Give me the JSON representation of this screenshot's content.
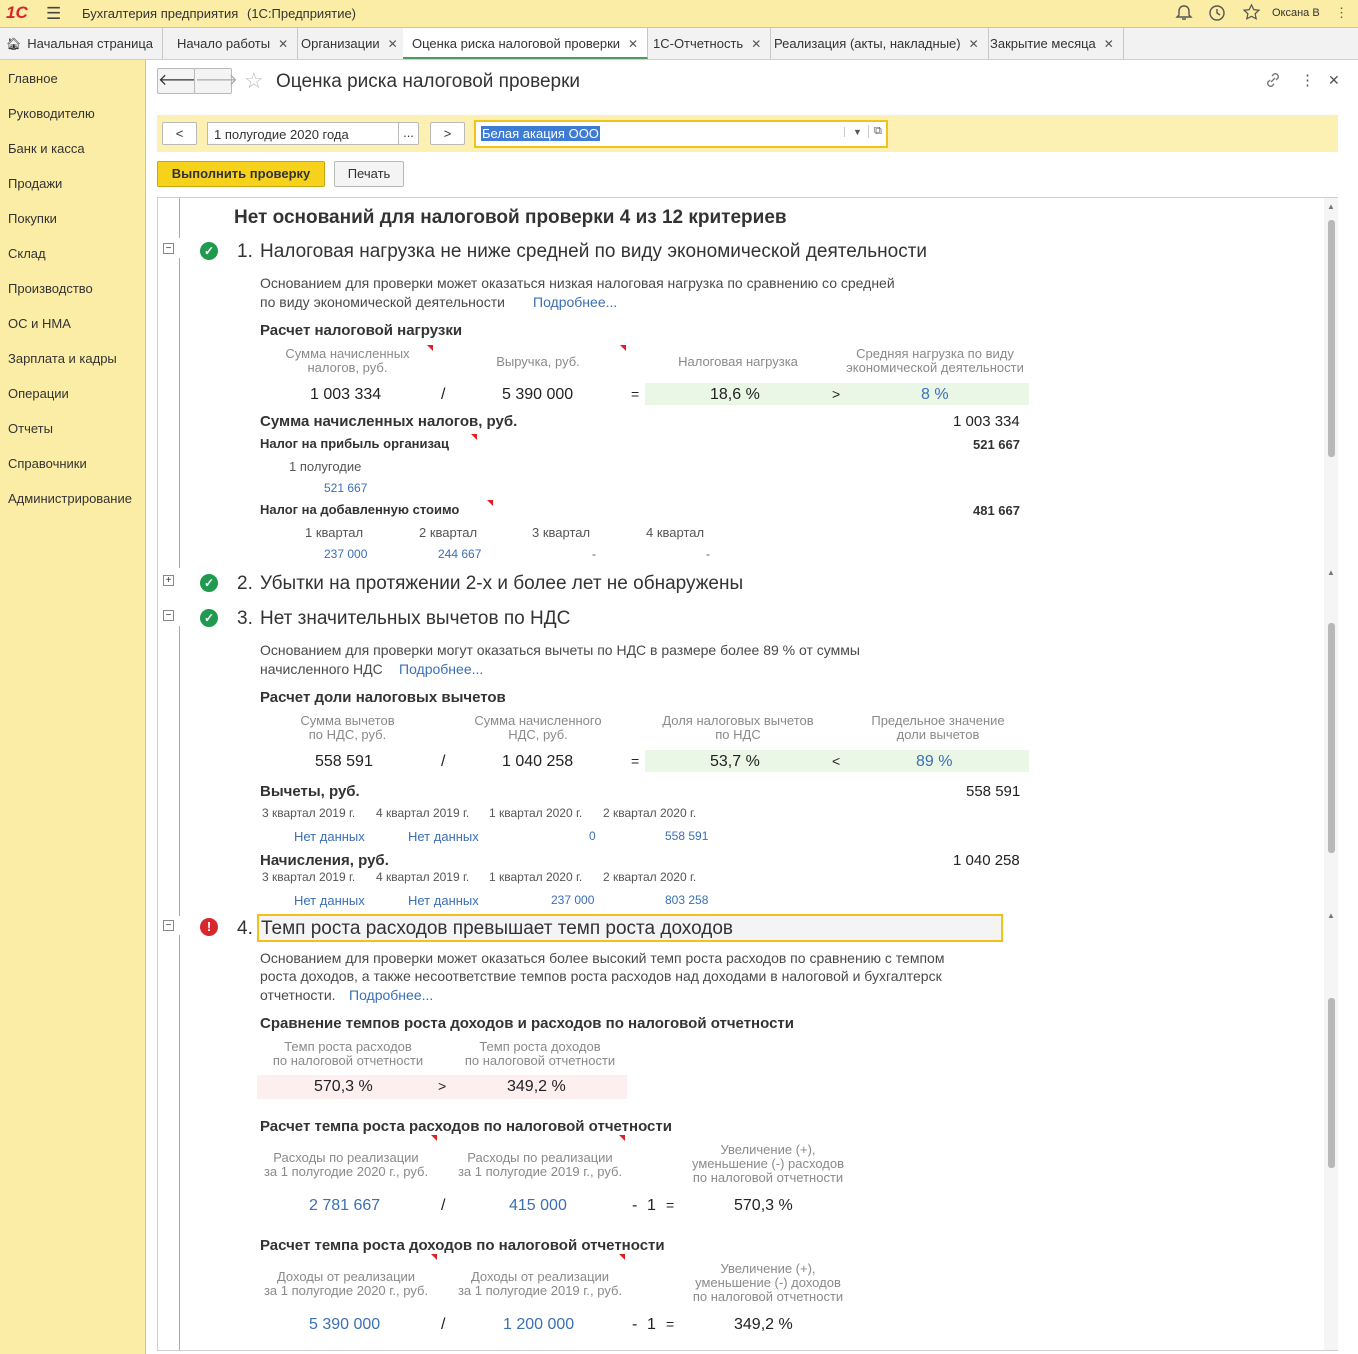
{
  "app": {
    "logo": "1С",
    "title": "Бухгалтерия предприятия",
    "platform": "(1С:Предприятие)",
    "user": "Оксана В"
  },
  "tabs": [
    {
      "label": "Начальная страница"
    },
    {
      "label": "Начало работы"
    },
    {
      "label": "Организации"
    },
    {
      "label": "Оценка риска налоговой проверки"
    },
    {
      "label": "1С-Отчетность"
    },
    {
      "label": "Реализация (акты, накладные)"
    },
    {
      "label": "Закрытие месяца"
    }
  ],
  "sidebar": {
    "items": [
      "Главное",
      "Руководителю",
      "Банк и касса",
      "Продажи",
      "Покупки",
      "Склад",
      "Производство",
      "ОС и НМА",
      "Зарплата и кадры",
      "Операции",
      "Отчеты",
      "Справочники",
      "Администрирование"
    ]
  },
  "page": {
    "title": "Оценка риска налоговой проверки"
  },
  "filter": {
    "prev": "<",
    "period": "1 полугодие 2020 года",
    "dots": "...",
    "next": ">",
    "org": "Белая акация ООО"
  },
  "actions": {
    "run": "Выполнить проверку",
    "print": "Печать"
  },
  "report": {
    "summary": "Нет оснований для налоговой проверки 4 из 12 критериев",
    "c1": {
      "num": "1.",
      "title": "Налоговая нагрузка не ниже средней по виду экономической деятельности",
      "desc1": "Основанием для проверки может оказаться низкая налоговая нагрузка по сравнению со средней",
      "desc2": "по виду экономической деятельности",
      "more": "Подробнее...",
      "calc_title": "Расчет налоговой нагрузки",
      "cap1a": "Сумма начисленных",
      "cap1b": "налогов, руб.",
      "cap2": "Выручка, руб.",
      "cap3": "Налоговая нагрузка",
      "cap4a": "Средняя нагрузка по виду",
      "cap4b": "экономической деятельности",
      "v1": "1 003 334",
      "op1": "/",
      "v2": "5 390 000",
      "op2": "=",
      "v3": "18,6 %",
      "op3": ">",
      "v4": "8 %",
      "sum_label": "Сумма начисленных налогов, руб.",
      "sum_value": "1 003 334",
      "profit_label": "Налог на прибыль организац",
      "profit_value": "521 667",
      "profit_period": "1 полугодие",
      "profit_period_value": "521 667",
      "vat_label": "Налог на добавленную стоимо",
      "vat_value": "481 667",
      "q1": "1 квартал",
      "q2": "2 квартал",
      "q3": "3 квартал",
      "q4": "4 квартал",
      "q1v": "237 000",
      "q2v": "244 667",
      "q3v": "-",
      "q4v": "-"
    },
    "c2": {
      "num": "2.",
      "title": "Убытки на протяжении 2-х и более лет не обнаружены"
    },
    "c3": {
      "num": "3.",
      "title": "Нет значительных вычетов по НДС",
      "desc1": "Основанием для проверки могут оказаться вычеты по НДС в размере более 89 % от суммы",
      "desc2": "начисленного НДС",
      "more": "Подробнее...",
      "calc_title": "Расчет доли налоговых вычетов",
      "cap1a": "Сумма вычетов",
      "cap1b": "по НДС, руб.",
      "cap2a": "Сумма начисленного",
      "cap2b": "НДС, руб.",
      "cap3a": "Доля налоговых вычетов",
      "cap3b": "по НДС",
      "cap4a": "Предельное значение",
      "cap4b": "доли вычетов",
      "v1": "558 591",
      "op1": "/",
      "v2": "1 040 258",
      "op2": "=",
      "v3": "53,7 %",
      "op3": "<",
      "v4": "89 %",
      "ded_label": "Вычеты, руб.",
      "ded_value": "558 591",
      "p1": "3 квартал 2019 г.",
      "p2": "4 квартал 2019 г.",
      "p3": "1 квартал 2020 г.",
      "p4": "2 квартал 2020 г.",
      "d1": "Нет данных",
      "d2": "Нет данных",
      "d3": "0",
      "d4": "558 591",
      "acc_label": "Начисления, руб.",
      "acc_value": "1 040 258",
      "a1": "Нет данных",
      "a2": "Нет данных",
      "a3": "237 000",
      "a4": "803 258"
    },
    "c4": {
      "num": "4.",
      "title": "Темп роста расходов превышает темп роста доходов",
      "desc1": "Основанием для проверки может оказаться более высокий темп роста расходов по сравнению с темпом",
      "desc2": "роста доходов, а также несоответствие темпов роста расходов над доходами в налоговой и бухгалтерск",
      "desc3": "отчетности.",
      "more": "Подробнее...",
      "cmp_title": "Сравнение темпов роста доходов и расходов по налоговой отчетности",
      "cmp_cap1a": "Темп роста расходов",
      "cmp_cap1b": "по налоговой отчетности",
      "cmp_cap2a": "Темп роста доходов",
      "cmp_cap2b": "по налоговой отчетности",
      "cmp_v1": "570,3 %",
      "cmp_op": ">",
      "cmp_v2": "349,2 %",
      "exp_title": "Расчет темпа роста расходов по налоговой отчетности",
      "exp_cap1a": "Расходы по реализации",
      "exp_cap1b": "за 1 полугодие 2020 г., руб.",
      "exp_cap2a": "Расходы по реализации",
      "exp_cap2b": "за 1 полугодие 2019 г., руб.",
      "exp_cap3a": "Увеличение (+),",
      "exp_cap3b": "уменьшение (-) расходов",
      "exp_cap3c": "по налоговой отчетности",
      "exp_v1": "2 781 667",
      "exp_v2": "415 000",
      "exp_v3": "570,3 %",
      "inc_title": "Расчет темпа роста доходов по налоговой отчетности",
      "inc_cap1a": "Доходы от реализации",
      "inc_cap1b": "за 1 полугодие 2020 г., руб.",
      "inc_cap2a": "Доходы от реализации",
      "inc_cap2b": "за 1 полугодие 2019 г., руб.",
      "inc_cap3a": "Увеличение (+),",
      "inc_cap3b": "уменьшение (-) доходов",
      "inc_cap3c": "по налоговой отчетности",
      "inc_v1": "5 390 000",
      "inc_v2": "1 200 000",
      "inc_v3": "349,2 %",
      "div": "/",
      "minus": "-",
      "one": "1",
      "eq": "="
    }
  },
  "colors": {
    "accent_yellow": "#fbeda5",
    "ok_green": "#1f9a4e",
    "error_red": "#d9272e",
    "link_blue": "#3b6fb6",
    "run_button": "#f7d21c"
  }
}
